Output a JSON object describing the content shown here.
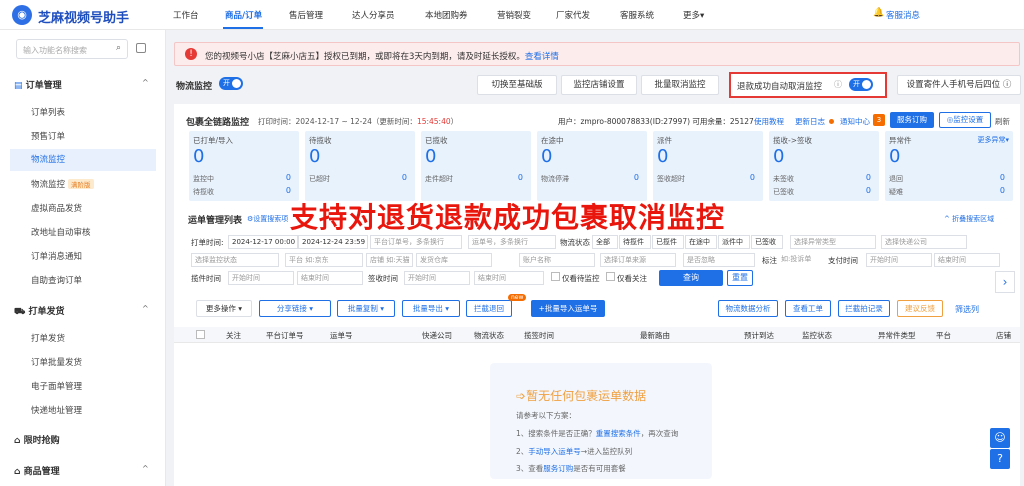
{
  "app": {
    "logo_glyph": "◉",
    "title": "芝麻视频号助手"
  },
  "nav": [
    "工作台",
    "商品/订单",
    "售后管理",
    "达人分享员",
    "本地团购券",
    "营销裂变",
    "厂家代发",
    "客服系统",
    "更多▾"
  ],
  "nav_right": "客服消息",
  "sidebar": {
    "search_placeholder": "输入功能名称搜索",
    "sections": [
      {
        "label": "订单管理",
        "items": [
          "订单列表",
          "预售订单",
          "物流监控",
          "物流监控",
          "虚拟商品发货",
          "改地址自动审核",
          "订单消息通知",
          "自助查询订单"
        ],
        "badge": "满阶版"
      },
      {
        "label": "打单发货",
        "items": [
          "打单发货",
          "订单批量发货",
          "电子面单管理",
          "快递地址管理"
        ]
      },
      {
        "label": "限时抢购",
        "items": []
      },
      {
        "label": "商品管理",
        "items": []
      }
    ]
  },
  "alert": {
    "text": "您的视频号小店【芝麻小店五】授权已到期，或即将在3天内到期，请及时延长授权。",
    "link": "查看详情"
  },
  "toolbar": {
    "title": "物流监控",
    "toggle": "开",
    "btn_switch": "切换至基础版",
    "btn_monitor_shop": "监控店铺设置",
    "btn_batch_cancel": "批量取消监控",
    "auto_cancel_label": "退款成功自动取消监控",
    "auto_toggle": "开",
    "btn_sender_phone": "设置寄件人手机号后四位"
  },
  "panel_header": {
    "title": "包裹全链路监控",
    "print_time": "打印时间：2024-12-17 ~ 12-24（更新时间：",
    "update_time": "15:45:40",
    "print_time_end": "）",
    "user": "用户：zmpro-800078833(ID:27997) 可用余量：25127",
    "tutorial": "使用教程",
    "changelog": "更新日志",
    "notice": "通知中心",
    "notice_count": "3",
    "btn_service": "服务订购",
    "btn_monitor_settings": "◎监控设置",
    "refresh": "刷新"
  },
  "cards": [
    {
      "title": "已打单/导入",
      "value": "0",
      "rows": [
        [
          "监控中",
          "0"
        ],
        [
          "待揽收",
          "0"
        ]
      ]
    },
    {
      "title": "待揽收",
      "value": "0",
      "rows": [
        [
          "已超时",
          "0"
        ]
      ]
    },
    {
      "title": "已揽收",
      "value": "0",
      "rows": [
        [
          "走件超时",
          "0"
        ]
      ]
    },
    {
      "title": "在途中",
      "value": "0",
      "rows": [
        [
          "物流停滞",
          "0"
        ]
      ]
    },
    {
      "title": "派件",
      "value": "0",
      "rows": [
        [
          "签收超时",
          "0"
        ]
      ]
    },
    {
      "title": "揽收->签收",
      "value": "0",
      "rows": [
        [
          "未签收",
          "0"
        ],
        [
          "已签收",
          "0"
        ]
      ]
    },
    {
      "title": "异常件",
      "value": "0",
      "extra": "更多异常▾",
      "rows": [
        [
          "退回",
          "0"
        ],
        [
          "疑难",
          "0"
        ]
      ]
    }
  ],
  "list_section": {
    "title": "运单管理列表",
    "settings_link": "⚙设置搜索项",
    "collapse": "^ 折叠搜索区域"
  },
  "filters": {
    "print_time_label": "打单时间:",
    "date_from": "2024-12-17 00:00",
    "date_to": "2024-12-24 23:59",
    "platform_order_ph": "平台订单号，多条换行",
    "waybill_ph": "运单号，多条换行",
    "logistics_label": "物流状态",
    "status_tabs": [
      "全部",
      "待揽件",
      "已揽件",
      "在途中",
      "派件中",
      "已签收"
    ],
    "exception_type_ph": "选择异常类型",
    "express_ph": "选择快递公司",
    "monitor_status_ph": "选择监控状态",
    "platform_ph": "平台 如:京东",
    "shop_ph": "店铺 如:天猫",
    "warehouse_ph": "发货仓库",
    "account_ph": "账户名称",
    "order_source_ph": "选择订单来源",
    "ignored_ph": "是否忽略",
    "tag_label": "标注",
    "tag_ph": "如:投诉单",
    "pay_time_label": "支付时间",
    "start_time": "开始时间",
    "end_time": "结束时间",
    "pick_time_label": "揽件时间",
    "sign_time_label": "签收时间",
    "only_monitor": "仅看待监控",
    "only_follow": "仅看关注",
    "btn_query": "查询",
    "btn_reset": "重置"
  },
  "actions": {
    "more_ops": "更多操作 ▾",
    "share_link": "分享链接 ▾",
    "batch_copy": "批量复制 ▾",
    "batch_export": "批量导出 ▾",
    "intercept": "拦截退回",
    "new_badge": "new",
    "batch_import": "+批量导入运单号",
    "logistics_analysis": "物流数据分析",
    "view_ticket": "查看工单",
    "intercept_records": "拦截拍记录",
    "feedback": "建议反馈",
    "filter_cols": "筛选列"
  },
  "table_headers": [
    "关注",
    "平台订单号",
    "运单号",
    "快递公司",
    "物流状态",
    "揽签时间",
    "最新路由",
    "预计到达",
    "监控状态",
    "异常件类型",
    "平台",
    "店铺"
  ],
  "overlay_text": "支持对退货退款成功包裹取消监控",
  "empty": {
    "title": "暂无任何包裹运单数据",
    "subtitle": "请参考以下方案：",
    "tip1": "1、搜索条件是否正确？",
    "tip1_link": "重置搜索条件",
    "tip1_end": "，再次查询",
    "tip2": "2、",
    "tip2_link": "手动导入运单号",
    "tip2_end": "→进入监控队列",
    "tip3": "3、查看",
    "tip3_link": "服务订购",
    "tip3_end": "是否有可用套餐"
  },
  "colors": {
    "primary": "#1f6fe6",
    "alert_red": "#e53935",
    "overlay_red": "#e8160c"
  }
}
